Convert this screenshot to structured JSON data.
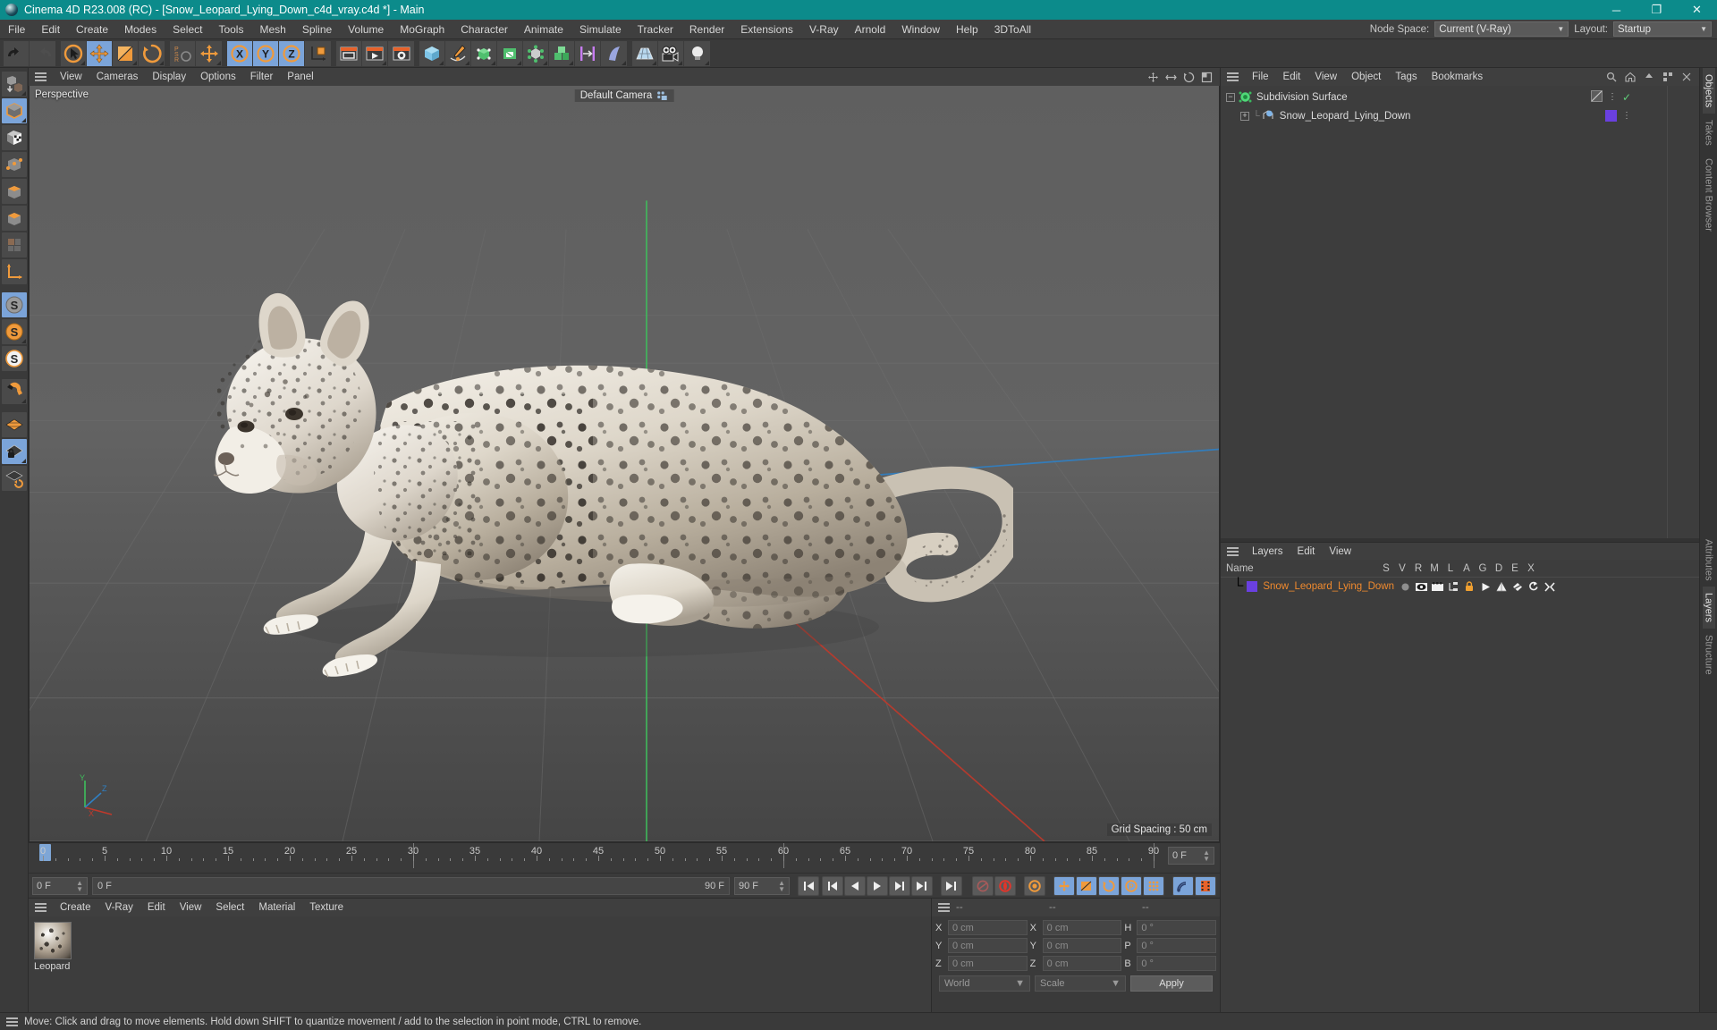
{
  "titlebar": {
    "app_title": "Cinema 4D R23.008 (RC) - [Snow_Leopard_Lying_Down_c4d_vray.c4d *] - Main",
    "minimize": "─",
    "maximize": "❐",
    "close": "✕"
  },
  "menubar": {
    "items": [
      "File",
      "Edit",
      "Create",
      "Modes",
      "Select",
      "Tools",
      "Mesh",
      "Spline",
      "Volume",
      "MoGraph",
      "Character",
      "Animate",
      "Simulate",
      "Tracker",
      "Render",
      "Extensions",
      "V-Ray",
      "Arnold",
      "Window",
      "Help",
      "3DToAll"
    ],
    "node_space_label": "Node Space:",
    "node_space_value": "Current (V-Ray)",
    "layout_label": "Layout:",
    "layout_value": "Startup"
  },
  "toolbar": {
    "groups": [
      {
        "icons": [
          {
            "name": "undo-icon",
            "glyph": "↶"
          },
          {
            "name": "redo-icon",
            "glyph": "↷"
          }
        ]
      },
      {
        "icons": [
          {
            "name": "live-selection-icon",
            "glyph": "◎"
          },
          {
            "name": "move-tool-icon",
            "glyph": "✛",
            "active": true
          },
          {
            "name": "scale-tool-icon",
            "glyph": "◰"
          },
          {
            "name": "rotate-tool-icon",
            "glyph": "↻"
          }
        ]
      },
      {
        "icons": [
          {
            "name": "psr-lock-icon",
            "glyph": "PSR"
          },
          {
            "name": "global-local-move-icon",
            "glyph": "✛"
          }
        ]
      },
      {
        "icons": [
          {
            "name": "x-axis-lock-icon",
            "glyph": "X",
            "active": true
          },
          {
            "name": "y-axis-lock-icon",
            "glyph": "Y",
            "active": true
          },
          {
            "name": "z-axis-lock-icon",
            "glyph": "Z",
            "active": true
          },
          {
            "name": "world-object-axis-icon",
            "glyph": "⤵"
          }
        ]
      },
      {
        "icons": [
          {
            "name": "render-view-icon",
            "glyph": "▭"
          },
          {
            "name": "render-to-picture-viewer-icon",
            "glyph": "▶"
          },
          {
            "name": "render-settings-icon",
            "glyph": "⚙"
          }
        ]
      },
      {
        "icons": [
          {
            "name": "add-cube-icon",
            "glyph": "■"
          },
          {
            "name": "add-spline-icon",
            "glyph": "✎"
          },
          {
            "name": "add-generator-icon",
            "glyph": "⬛"
          },
          {
            "name": "add-spline-generator-icon",
            "glyph": "▢"
          },
          {
            "name": "add-deformer-icon",
            "glyph": "⬡"
          },
          {
            "name": "add-mograph-icon",
            "glyph": "⬚"
          },
          {
            "name": "add-field-icon",
            "glyph": "⇥"
          },
          {
            "name": "add-hair-icon",
            "glyph": "⌇"
          }
        ]
      },
      {
        "icons": [
          {
            "name": "add-floor-icon",
            "glyph": "▤"
          },
          {
            "name": "add-camera-icon",
            "glyph": "◱"
          },
          {
            "name": "add-light-icon",
            "glyph": "●"
          }
        ]
      }
    ]
  },
  "left_toolbar": {
    "icons": [
      {
        "name": "make-editable-icon",
        "glyph": "⬇"
      },
      {
        "name": "model-mode-icon",
        "glyph": "■",
        "active": true
      },
      {
        "name": "texture-mode-icon",
        "glyph": "▦"
      },
      {
        "name": "point-mode-icon",
        "glyph": "●"
      },
      {
        "name": "edge-mode-icon",
        "glyph": "╱"
      },
      {
        "name": "polygon-mode-icon",
        "glyph": "▰"
      },
      {
        "name": "uv-mode-icon",
        "glyph": "▣"
      },
      {
        "name": "axis-mode-icon",
        "glyph": "∟"
      },
      {
        "name": "enable-axis-icon",
        "glyph": "S",
        "active": true
      },
      {
        "name": "enable-snapping-icon",
        "glyph": "S"
      },
      {
        "name": "quantize-icon",
        "glyph": "S"
      },
      {
        "name": "magnet-icon",
        "glyph": "☂"
      },
      {
        "name": "workplane-icon",
        "glyph": "▦"
      },
      {
        "name": "lock-workplane-icon",
        "glyph": "⚿",
        "active": true
      },
      {
        "name": "planar-workplane-icon",
        "glyph": "↻"
      }
    ]
  },
  "viewport": {
    "menu_items": [
      "View",
      "Cameras",
      "Display",
      "Options",
      "Filter",
      "Panel"
    ],
    "label": "Perspective",
    "camera": "Default Camera",
    "grid_spacing": "Grid Spacing : 50 cm",
    "axis_x": "X",
    "axis_y": "Y",
    "axis_z": "Z"
  },
  "timeline": {
    "ticks": [
      0,
      5,
      10,
      15,
      20,
      25,
      30,
      35,
      40,
      45,
      50,
      55,
      60,
      65,
      70,
      75,
      80,
      85,
      90
    ],
    "start_frame": "0 F",
    "end_frame": "90 F",
    "current_frame": "0 F",
    "preview_min": "0 F",
    "preview_max": "90 F",
    "doc_end": "90 F",
    "buttons": [
      {
        "name": "go-to-start-button",
        "glyph": "⏮"
      },
      {
        "name": "go-to-previous-key-button",
        "glyph": "◀|"
      },
      {
        "name": "step-back-button",
        "glyph": "◀"
      },
      {
        "name": "play-button",
        "glyph": "▶"
      },
      {
        "name": "step-forward-button",
        "glyph": "▶|"
      },
      {
        "name": "go-to-next-key-button",
        "glyph": "⏭"
      },
      {
        "name": "go-to-end-button",
        "glyph": "⏭"
      }
    ],
    "toggles": [
      {
        "name": "record-active-objects-button",
        "glyph": "⚿"
      },
      {
        "name": "autokeying-button",
        "glyph": "◉"
      },
      {
        "name": "keyframe-selection-button",
        "glyph": "⚙"
      },
      {
        "name": "position-key-button",
        "glyph": "✛",
        "active": true
      },
      {
        "name": "scale-key-button",
        "glyph": "◰",
        "active": true
      },
      {
        "name": "rotation-key-button",
        "glyph": "↻",
        "active": true
      },
      {
        "name": "parameter-key-button",
        "glyph": "P",
        "active": true
      },
      {
        "name": "point-level-animation-button",
        "glyph": "⁙",
        "active": true
      },
      {
        "name": "dynamics-button",
        "glyph": "◠"
      },
      {
        "name": "make-preview-button",
        "glyph": "▤"
      }
    ]
  },
  "material_manager": {
    "menu_items": [
      "Create",
      "V-Ray",
      "Edit",
      "View",
      "Select",
      "Material",
      "Texture"
    ],
    "materials": [
      {
        "name": "Leopard"
      }
    ]
  },
  "coordinates": {
    "header": [
      "--",
      "--",
      "--"
    ],
    "rows": [
      {
        "label1": "X",
        "value1": "0 cm",
        "label2": "X",
        "value2": "0 cm",
        "label3": "H",
        "value3": "0 °"
      },
      {
        "label1": "Y",
        "value1": "0 cm",
        "label2": "Y",
        "value2": "0 cm",
        "label3": "P",
        "value3": "0 °"
      },
      {
        "label1": "Z",
        "value1": "0 cm",
        "label2": "Z",
        "value2": "0 cm",
        "label3": "B",
        "value3": "0 °"
      }
    ],
    "space_select": "World",
    "mode_select": "Scale",
    "apply_button": "Apply"
  },
  "object_manager": {
    "menu_items": [
      "File",
      "Edit",
      "View",
      "Object",
      "Tags",
      "Bookmarks"
    ],
    "objects": [
      {
        "name": "Subdivision Surface",
        "icon": "subdivision-surface-icon",
        "indent": 0
      },
      {
        "name": "Snow_Leopard_Lying_Down",
        "icon": "polygon-object-icon",
        "indent": 1
      }
    ]
  },
  "layers_manager": {
    "menu_items": [
      "Layers",
      "Edit",
      "View"
    ],
    "name_header": "Name",
    "columns": [
      "S",
      "V",
      "R",
      "M",
      "L",
      "A",
      "G",
      "D",
      "E",
      "X"
    ],
    "rows": [
      {
        "name": "Snow_Leopard_Lying_Down",
        "color": "#6a40e0"
      }
    ]
  },
  "tab_rail": {
    "top_tabs": [
      "Objects",
      "Takes",
      "Content Browser"
    ],
    "bottom_tabs": [
      "Attributes",
      "Layers",
      "Structure"
    ]
  },
  "statusbar": {
    "message": "Move: Click and drag to move elements. Hold down SHIFT to quantize movement / add to the selection in point mode, CTRL to remove."
  },
  "colors": {
    "title_bar": "#0c8b8b",
    "accent_blue": "#7ba4d9",
    "accent_orange": "#f08a2e",
    "layer_purple": "#6a40e0",
    "axis_x": "#c0392b",
    "axis_y": "#27ae60",
    "axis_z": "#2980b9"
  }
}
